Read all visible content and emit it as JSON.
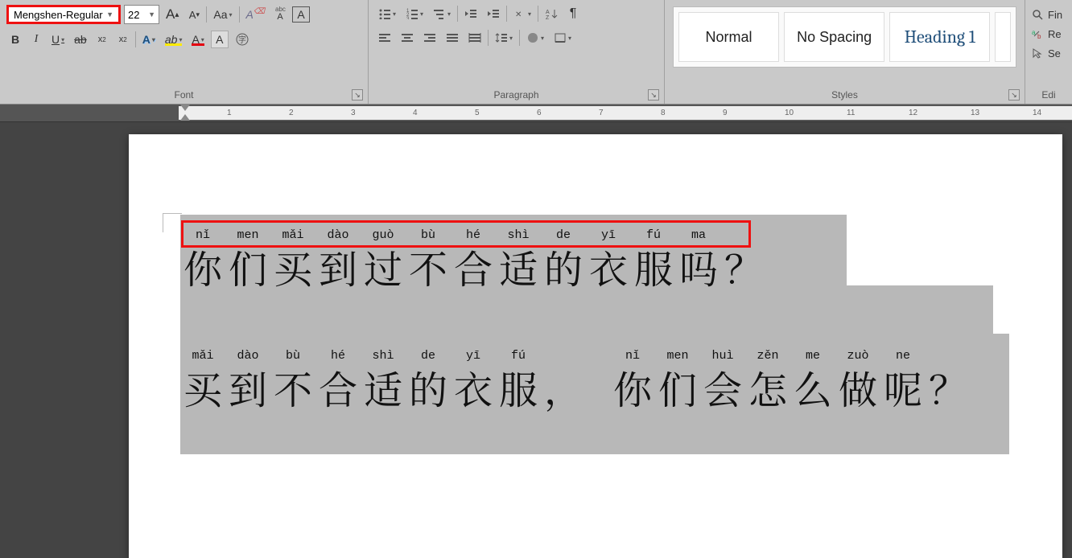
{
  "font": {
    "name": "Mengshen-Regular",
    "size": "22",
    "group_label": "Font",
    "bold": "B",
    "italic": "I",
    "underline": "U",
    "strike": "ab",
    "sub": "x",
    "sup": "x",
    "grow": "A",
    "shrink": "A",
    "case": "Aa",
    "clear": "A",
    "charborder": "A",
    "teffects": "A",
    "highlight": "ab",
    "fontcolor": "A",
    "shade": "A"
  },
  "para": {
    "group_label": "Paragraph"
  },
  "styles": {
    "group_label": "Styles",
    "normal": "Normal",
    "nospacing": "No Spacing",
    "heading1": "Heading 1"
  },
  "edit": {
    "group_label": "Edi",
    "find": "Fin",
    "replace": "Re",
    "select": "Se"
  },
  "ruler_numbers": [
    1,
    2,
    3,
    4,
    5,
    6,
    7,
    8,
    9,
    10,
    11,
    12,
    13,
    14
  ],
  "doc": {
    "line1": {
      "chars": [
        {
          "py": "nǐ",
          "hz": "你"
        },
        {
          "py": "men",
          "hz": "们"
        },
        {
          "py": "mǎi",
          "hz": "买"
        },
        {
          "py": "dào",
          "hz": "到"
        },
        {
          "py": "guò",
          "hz": "过"
        },
        {
          "py": "bù",
          "hz": "不"
        },
        {
          "py": "hé",
          "hz": "合"
        },
        {
          "py": "shì",
          "hz": "适"
        },
        {
          "py": "de",
          "hz": "的"
        },
        {
          "py": "yī",
          "hz": "衣"
        },
        {
          "py": "fú",
          "hz": "服"
        },
        {
          "py": "ma",
          "hz": "吗"
        }
      ],
      "end": "？"
    },
    "line2": {
      "part1": [
        {
          "py": "mǎi",
          "hz": "买"
        },
        {
          "py": "dào",
          "hz": "到"
        },
        {
          "py": "bù",
          "hz": "不"
        },
        {
          "py": "hé",
          "hz": "合"
        },
        {
          "py": "shì",
          "hz": "适"
        },
        {
          "py": "de",
          "hz": "的"
        },
        {
          "py": "yī",
          "hz": "衣"
        },
        {
          "py": "fú",
          "hz": "服"
        }
      ],
      "mid": "，",
      "part2": [
        {
          "py": "nǐ",
          "hz": "你"
        },
        {
          "py": "men",
          "hz": "们"
        },
        {
          "py": "huì",
          "hz": "会"
        },
        {
          "py": "zěn",
          "hz": "怎"
        },
        {
          "py": "me",
          "hz": "么"
        },
        {
          "py": "zuò",
          "hz": "做"
        },
        {
          "py": "ne",
          "hz": "呢"
        }
      ],
      "end": "？"
    }
  }
}
